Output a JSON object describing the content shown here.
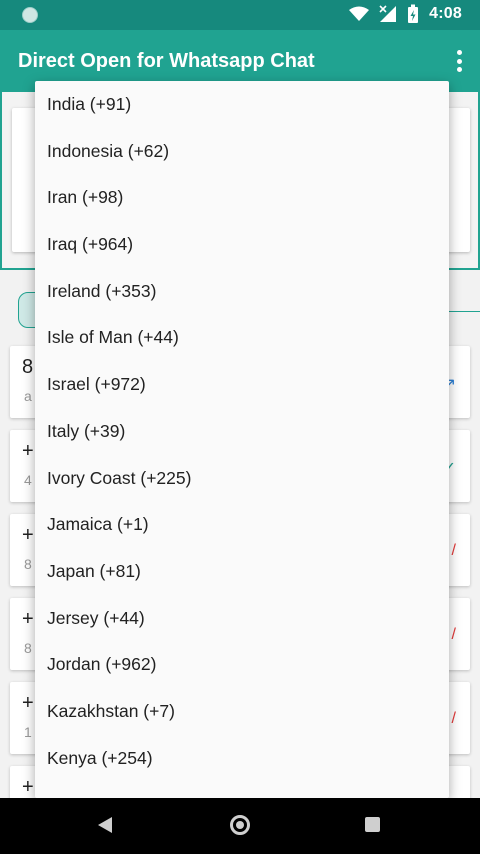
{
  "status_bar": {
    "time": "4:08",
    "icons": [
      "notification-dot-icon",
      "wifi-icon",
      "signal-icon",
      "battery-charging-icon"
    ]
  },
  "app_bar": {
    "title": "Direct Open for Whatsapp Chat",
    "menu_icon": "overflow-menu-icon"
  },
  "background": {
    "history": [
      {
        "main": "8",
        "sub": "a",
        "icon": "open-icon",
        "icon_color": "#2a7fd6"
      },
      {
        "main": "+",
        "sub": "4",
        "icon": "check-icon",
        "icon_color": "#21a391"
      },
      {
        "main": "+",
        "sub": "8",
        "icon": "slash-icon",
        "icon_color": "#e23b3b"
      },
      {
        "main": "+",
        "sub": "8",
        "icon": "slash-icon",
        "icon_color": "#e23b3b"
      },
      {
        "main": "+",
        "sub": "1",
        "icon": "slash-icon",
        "icon_color": "#e23b3b"
      },
      {
        "main": "+",
        "sub": "",
        "icon": "",
        "icon_color": "#999999"
      }
    ]
  },
  "dropdown": {
    "items": [
      "India (+91)",
      "Indonesia (+62)",
      "Iran (+98)",
      "Iraq (+964)",
      "Ireland (+353)",
      "Isle of Man (+44)",
      "Israel (+972)",
      "Italy (+39)",
      "Ivory Coast (+225)",
      "Jamaica (+1)",
      "Japan (+81)",
      "Jersey (+44)",
      "Jordan (+962)",
      "Kazakhstan (+7)",
      "Kenya (+254)"
    ]
  },
  "nav_bar": {
    "icons": [
      "back-icon",
      "home-icon",
      "recents-icon"
    ]
  },
  "colors": {
    "status_bar": "#16897d",
    "app_bar": "#20a391",
    "accent": "#21a391",
    "dropdown_bg": "#fafafa",
    "nav_bar": "#000000"
  }
}
